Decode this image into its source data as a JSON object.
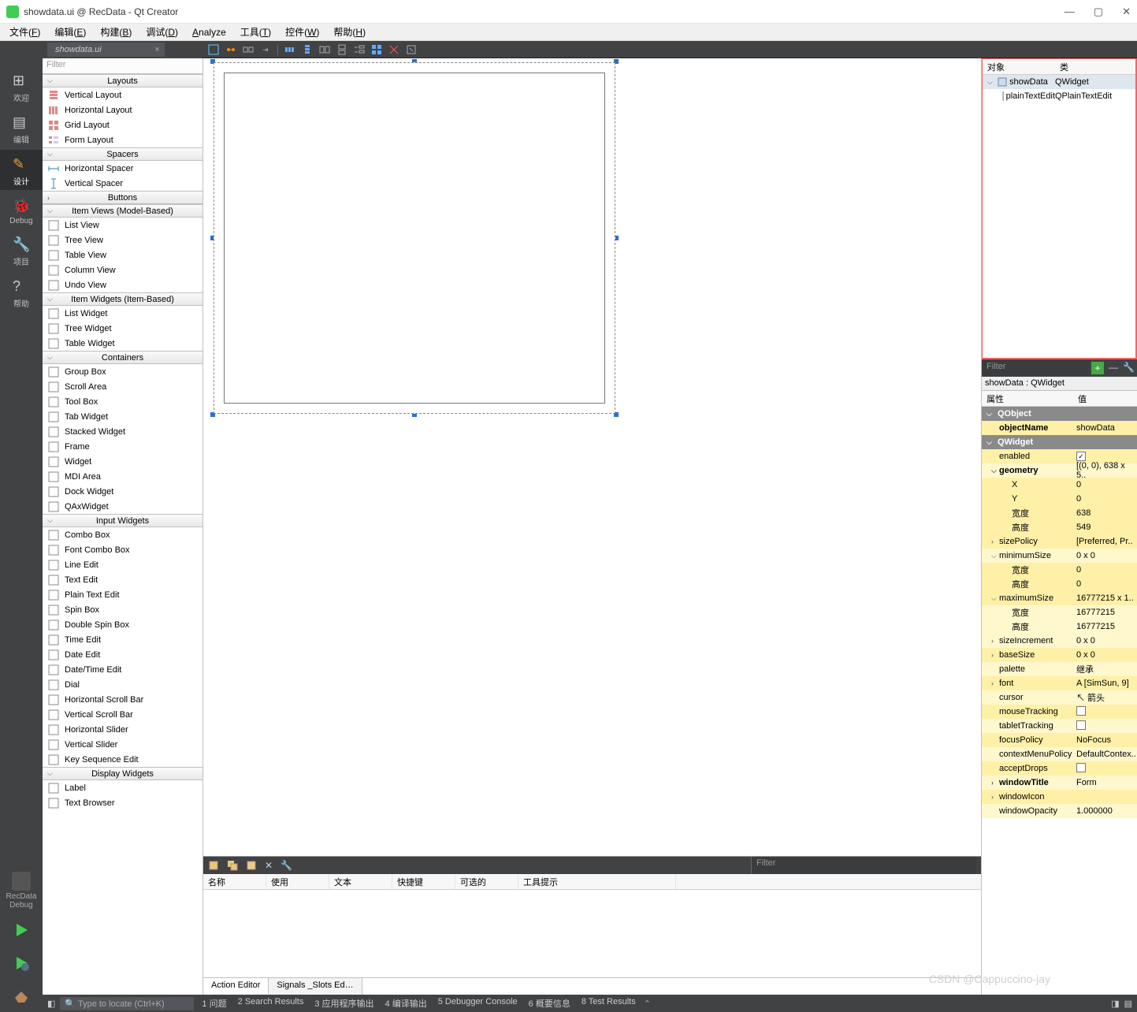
{
  "titlebar": {
    "title": "showdata.ui @ RecData - Qt Creator"
  },
  "menubar": [
    {
      "label": "文件",
      "key": "F"
    },
    {
      "label": "编辑",
      "key": "E"
    },
    {
      "label": "构建",
      "key": "B"
    },
    {
      "label": "调试",
      "key": "D"
    },
    {
      "label": "Analyze",
      "key": ""
    },
    {
      "label": "工具",
      "key": "T"
    },
    {
      "label": "控件",
      "key": "W"
    },
    {
      "label": "帮助",
      "key": "H"
    }
  ],
  "open_tab": "showdata.ui",
  "modes": [
    {
      "label": "欢迎"
    },
    {
      "label": "编辑"
    },
    {
      "label": "设计"
    },
    {
      "label": "Debug"
    },
    {
      "label": "项目"
    },
    {
      "label": "帮助"
    }
  ],
  "kit": {
    "name": "RecData",
    "config": "Debug"
  },
  "widgetbox": {
    "filter_placeholder": "Filter",
    "groups": [
      {
        "title": "Layouts",
        "items": [
          "Vertical Layout",
          "Horizontal Layout",
          "Grid Layout",
          "Form Layout"
        ]
      },
      {
        "title": "Spacers",
        "items": [
          "Horizontal Spacer",
          "Vertical Spacer"
        ]
      },
      {
        "title": "Buttons",
        "items": []
      },
      {
        "title": "Item Views (Model-Based)",
        "items": [
          "List View",
          "Tree View",
          "Table View",
          "Column View",
          "Undo View"
        ]
      },
      {
        "title": "Item Widgets (Item-Based)",
        "items": [
          "List Widget",
          "Tree Widget",
          "Table Widget"
        ]
      },
      {
        "title": "Containers",
        "items": [
          "Group Box",
          "Scroll Area",
          "Tool Box",
          "Tab Widget",
          "Stacked Widget",
          "Frame",
          "Widget",
          "MDI Area",
          "Dock Widget",
          "QAxWidget"
        ]
      },
      {
        "title": "Input Widgets",
        "items": [
          "Combo Box",
          "Font Combo Box",
          "Line Edit",
          "Text Edit",
          "Plain Text Edit",
          "Spin Box",
          "Double Spin Box",
          "Time Edit",
          "Date Edit",
          "Date/Time Edit",
          "Dial",
          "Horizontal Scroll Bar",
          "Vertical Scroll Bar",
          "Horizontal Slider",
          "Vertical Slider",
          "Key Sequence Edit"
        ]
      },
      {
        "title": "Display Widgets",
        "items": [
          "Label",
          "Text Browser"
        ]
      }
    ]
  },
  "object_tree": {
    "headers": {
      "obj": "对象",
      "cls": "类"
    },
    "rows": [
      {
        "obj": "showData",
        "cls": "QWidget",
        "sel": true,
        "depth": 0
      },
      {
        "obj": "plainTextEdit",
        "cls": "QPlainTextEdit",
        "sel": false,
        "depth": 1
      }
    ]
  },
  "prop_filter_placeholder": "Filter",
  "prop_context": "showData : QWidget",
  "prop_headers": {
    "k": "属性",
    "v": "值"
  },
  "properties": [
    {
      "type": "group",
      "label": "QObject"
    },
    {
      "type": "row",
      "k": "objectName",
      "v": "showData",
      "bold": true
    },
    {
      "type": "group",
      "label": "QWidget"
    },
    {
      "type": "row",
      "k": "enabled",
      "v": "[check]",
      "check": true
    },
    {
      "type": "row",
      "k": "geometry",
      "v": "[(0, 0), 638 x 5..",
      "bold": true,
      "exp": "v"
    },
    {
      "type": "row",
      "k": "X",
      "v": "0",
      "ind": 1
    },
    {
      "type": "row",
      "k": "Y",
      "v": "0",
      "ind": 1
    },
    {
      "type": "row",
      "k": "宽度",
      "v": "638",
      "ind": 1
    },
    {
      "type": "row",
      "k": "高度",
      "v": "549",
      "ind": 1
    },
    {
      "type": "row",
      "k": "sizePolicy",
      "v": "[Preferred, Pr..",
      "exp": ">"
    },
    {
      "type": "row",
      "k": "minimumSize",
      "v": "0 x 0",
      "exp": "v"
    },
    {
      "type": "row",
      "k": "宽度",
      "v": "0",
      "ind": 1
    },
    {
      "type": "row",
      "k": "高度",
      "v": "0",
      "ind": 1
    },
    {
      "type": "row",
      "k": "maximumSize",
      "v": "16777215 x 1..",
      "exp": "v"
    },
    {
      "type": "row",
      "k": "宽度",
      "v": "16777215",
      "ind": 1
    },
    {
      "type": "row",
      "k": "高度",
      "v": "16777215",
      "ind": 1
    },
    {
      "type": "row",
      "k": "sizeIncrement",
      "v": "0 x 0",
      "exp": ">"
    },
    {
      "type": "row",
      "k": "baseSize",
      "v": "0 x 0",
      "exp": ">"
    },
    {
      "type": "row",
      "k": "palette",
      "v": "继承"
    },
    {
      "type": "row",
      "k": "font",
      "v": "A  [SimSun, 9]",
      "exp": ">"
    },
    {
      "type": "row",
      "k": "cursor",
      "v": "↖ 箭头"
    },
    {
      "type": "row",
      "k": "mouseTracking",
      "v": "[check]",
      "check": false
    },
    {
      "type": "row",
      "k": "tabletTracking",
      "v": "[check]",
      "check": false
    },
    {
      "type": "row",
      "k": "focusPolicy",
      "v": "NoFocus"
    },
    {
      "type": "row",
      "k": "contextMenuPolicy",
      "v": "DefaultContex.."
    },
    {
      "type": "row",
      "k": "acceptDrops",
      "v": "[check]",
      "check": false
    },
    {
      "type": "row",
      "k": "windowTitle",
      "v": "Form",
      "bold": true,
      "exp": ">"
    },
    {
      "type": "row",
      "k": "windowIcon",
      "v": "",
      "exp": ">"
    },
    {
      "type": "row",
      "k": "windowOpacity",
      "v": "1.000000"
    }
  ],
  "action_editor": {
    "filter_placeholder": "Filter",
    "headers": [
      "名称",
      "使用",
      "文本",
      "快捷键",
      "可选的",
      "工具提示"
    ],
    "tabs": [
      "Action Editor",
      "Signals _Slots Ed…"
    ]
  },
  "statusbar": {
    "search_placeholder": "Type to locate (Ctrl+K)",
    "items": [
      "1 问题",
      "2 Search Results",
      "3 应用程序输出",
      "4 编译输出",
      "5 Debugger Console",
      "6 概要信息",
      "8 Test Results"
    ]
  },
  "watermark": "CSDN @Cappuccino-jay"
}
